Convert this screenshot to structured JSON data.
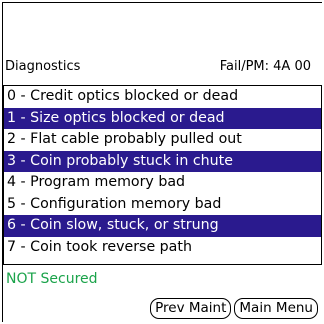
{
  "header": {
    "title": "Diagnostics",
    "fail_code": "Fail/PM: 4A 00"
  },
  "list": {
    "items": [
      {
        "label": "0 - Credit optics blocked or dead",
        "selected": false
      },
      {
        "label": "1 - Size optics blocked or dead",
        "selected": true
      },
      {
        "label": "2 - Flat cable probably pulled out",
        "selected": false
      },
      {
        "label": "3 - Coin probably stuck in chute",
        "selected": true
      },
      {
        "label": "4 - Program memory bad",
        "selected": false
      },
      {
        "label": "5 - Configuration memory bad",
        "selected": false
      },
      {
        "label": "6 - Coin slow, stuck, or strung",
        "selected": true
      },
      {
        "label": "7 - Coin took reverse path",
        "selected": false
      }
    ]
  },
  "status": {
    "text": "NOT Secured",
    "color": "#1aa34a"
  },
  "buttons": {
    "prev_maint": "Prev Maint",
    "main_menu": "Main Menu"
  },
  "colors": {
    "selection": "#2a1a8e",
    "background": "#ffffff"
  }
}
